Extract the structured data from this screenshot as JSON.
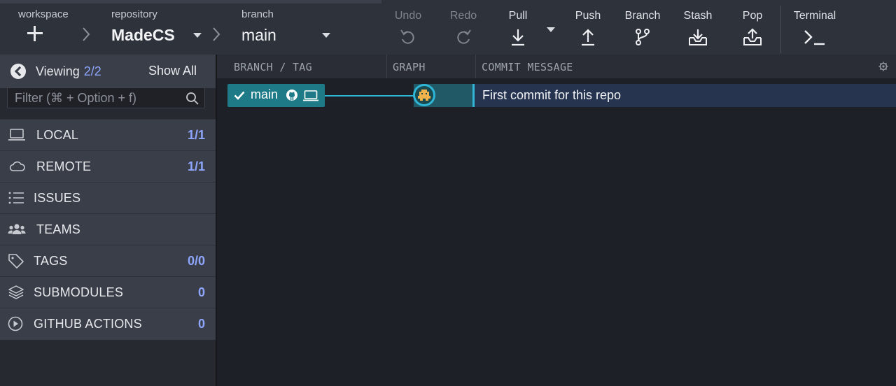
{
  "toolbar": {
    "workspace": {
      "label": "workspace"
    },
    "repository": {
      "label": "repository",
      "value": "MadeCS"
    },
    "branch": {
      "label": "branch",
      "value": "main"
    },
    "actions": {
      "undo": "Undo",
      "redo": "Redo",
      "pull": "Pull",
      "push": "Push",
      "branch": "Branch",
      "stash": "Stash",
      "pop": "Pop",
      "terminal": "Terminal"
    }
  },
  "sidebar": {
    "viewing_label": "Viewing",
    "viewing_count": "2/2",
    "show_all": "Show All",
    "filter_placeholder": "Filter (⌘ + Option + f)",
    "items": [
      {
        "label": "LOCAL",
        "count": "1/1",
        "icon": "laptop-icon"
      },
      {
        "label": "REMOTE",
        "count": "1/1",
        "icon": "cloud-icon"
      },
      {
        "label": "ISSUES",
        "count": "",
        "icon": "list-icon"
      },
      {
        "label": "TEAMS",
        "count": "",
        "icon": "users-icon"
      },
      {
        "label": "TAGS",
        "count": "0/0",
        "icon": "tag-icon"
      },
      {
        "label": "SUBMODULES",
        "count": "0",
        "icon": "layers-icon"
      },
      {
        "label": "GITHUB ACTIONS",
        "count": "0",
        "icon": "play-circle-icon"
      }
    ]
  },
  "graph": {
    "columns": {
      "branch_tag": "BRANCH / TAG",
      "graph": "GRAPH",
      "commit_message": "COMMIT MESSAGE"
    },
    "commits": [
      {
        "branch": "main",
        "message": "First commit for this repo"
      }
    ]
  },
  "colors": {
    "accent": "#2fb6d6",
    "count_blue": "#8fa6ff",
    "branch_pill": "#1e7a87",
    "selected_row": "#273450"
  }
}
